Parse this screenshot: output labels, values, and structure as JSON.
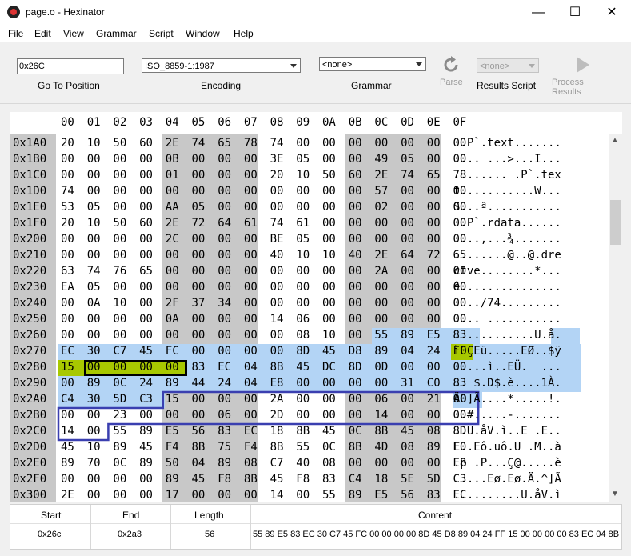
{
  "window": {
    "title": "page.o - Hexinator",
    "minimize": "—",
    "maximize": "☐",
    "close": "✕"
  },
  "menu": [
    "File",
    "Edit",
    "View",
    "Grammar",
    "Script",
    "Window",
    "Help"
  ],
  "toolbar": {
    "goto_value": "0x26C",
    "goto_label": "Go To Position",
    "encoding_value": "ISO_8859-1:1987",
    "encoding_label": "Encoding",
    "grammar_value": "<none>",
    "grammar_label": "Grammar",
    "parse_label": "Parse",
    "script_value": "<none>",
    "script_label": "Results Script",
    "process_label": "Process Results",
    "icons": {
      "parse": "refresh-icon",
      "process": "play-icon"
    }
  },
  "hex": {
    "columns": [
      "00",
      "01",
      "02",
      "03",
      "04",
      "05",
      "06",
      "07",
      "08",
      "09",
      "0A",
      "0B",
      "0C",
      "0D",
      "0E",
      "0F"
    ],
    "rows": [
      {
        "offset": "0x1A0",
        "bytes": [
          "20",
          "10",
          "50",
          "60",
          "2E",
          "74",
          "65",
          "78",
          "74",
          "00",
          "00",
          "00",
          "00",
          "00",
          "00",
          "00"
        ],
        "ascii": " .P`.text......."
      },
      {
        "offset": "0x1B0",
        "bytes": [
          "00",
          "00",
          "00",
          "00",
          "0B",
          "00",
          "00",
          "00",
          "3E",
          "05",
          "00",
          "00",
          "49",
          "05",
          "00",
          "00"
        ],
        "ascii": ".... ...>...I..."
      },
      {
        "offset": "0x1C0",
        "bytes": [
          "00",
          "00",
          "00",
          "00",
          "01",
          "00",
          "00",
          "00",
          "20",
          "10",
          "50",
          "60",
          "2E",
          "74",
          "65",
          "78"
        ],
        "ascii": "........ .P`.tex"
      },
      {
        "offset": "0x1D0",
        "bytes": [
          "74",
          "00",
          "00",
          "00",
          "00",
          "00",
          "00",
          "00",
          "00",
          "00",
          "00",
          "00",
          "57",
          "00",
          "00",
          "00"
        ],
        "ascii": "t...........W..."
      },
      {
        "offset": "0x1E0",
        "bytes": [
          "53",
          "05",
          "00",
          "00",
          "AA",
          "05",
          "00",
          "00",
          "00",
          "00",
          "00",
          "00",
          "02",
          "00",
          "00",
          "00"
        ],
        "ascii": "S...ª..........."
      },
      {
        "offset": "0x1F0",
        "bytes": [
          "20",
          "10",
          "50",
          "60",
          "2E",
          "72",
          "64",
          "61",
          "74",
          "61",
          "00",
          "00",
          "00",
          "00",
          "00",
          "00"
        ],
        "ascii": " .P`.rdata......"
      },
      {
        "offset": "0x200",
        "bytes": [
          "00",
          "00",
          "00",
          "00",
          "2C",
          "00",
          "00",
          "00",
          "BE",
          "05",
          "00",
          "00",
          "00",
          "00",
          "00",
          "00"
        ],
        "ascii": "....,...¾......."
      },
      {
        "offset": "0x210",
        "bytes": [
          "00",
          "00",
          "00",
          "00",
          "00",
          "00",
          "00",
          "00",
          "40",
          "10",
          "10",
          "40",
          "2E",
          "64",
          "72",
          "65"
        ],
        "ascii": "........@..@.dre"
      },
      {
        "offset": "0x220",
        "bytes": [
          "63",
          "74",
          "76",
          "65",
          "00",
          "00",
          "00",
          "00",
          "00",
          "00",
          "00",
          "00",
          "2A",
          "00",
          "00",
          "00"
        ],
        "ascii": "ctve........*..."
      },
      {
        "offset": "0x230",
        "bytes": [
          "EA",
          "05",
          "00",
          "00",
          "00",
          "00",
          "00",
          "00",
          "00",
          "00",
          "00",
          "00",
          "00",
          "00",
          "00",
          "00"
        ],
        "ascii": "ê..............."
      },
      {
        "offset": "0x240",
        "bytes": [
          "00",
          "0A",
          "10",
          "00",
          "2F",
          "37",
          "34",
          "00",
          "00",
          "00",
          "00",
          "00",
          "00",
          "00",
          "00",
          "00"
        ],
        "ascii": ". ../74........."
      },
      {
        "offset": "0x250",
        "bytes": [
          "00",
          "00",
          "00",
          "00",
          "0A",
          "00",
          "00",
          "00",
          "14",
          "06",
          "00",
          "00",
          "00",
          "00",
          "00",
          "00"
        ],
        "ascii": ".... ..........."
      },
      {
        "offset": "0x260",
        "bytes": [
          "00",
          "00",
          "00",
          "00",
          "00",
          "00",
          "00",
          "00",
          "00",
          "08",
          "10",
          "00",
          "55",
          "89",
          "E5",
          "83"
        ],
        "ascii": "............U.å."
      },
      {
        "offset": "0x270",
        "bytes": [
          "EC",
          "30",
          "C7",
          "45",
          "FC",
          "00",
          "00",
          "00",
          "00",
          "8D",
          "45",
          "D8",
          "89",
          "04",
          "24",
          "FF"
        ],
        "ascii": "ì0ÇEü.....EØ..$ÿ"
      },
      {
        "offset": "0x280",
        "bytes": [
          "15",
          "00",
          "00",
          "00",
          "00",
          "83",
          "EC",
          "04",
          "8B",
          "45",
          "DC",
          "8D",
          "0D",
          "00",
          "00",
          "00"
        ],
        "ascii": ".....ì..EÜ.  ..."
      },
      {
        "offset": "0x290",
        "bytes": [
          "00",
          "89",
          "0C",
          "24",
          "89",
          "44",
          "24",
          "04",
          "E8",
          "00",
          "00",
          "00",
          "00",
          "31",
          "C0",
          "83"
        ],
        "ascii": ".. $.D$.è....1À."
      },
      {
        "offset": "0x2A0",
        "bytes": [
          "C4",
          "30",
          "5D",
          "C3",
          "15",
          "00",
          "00",
          "00",
          "2A",
          "00",
          "00",
          "00",
          "06",
          "00",
          "21",
          "00"
        ],
        "ascii": "Ä0]Ã....*.....!."
      },
      {
        "offset": "0x2B0",
        "bytes": [
          "00",
          "00",
          "23",
          "00",
          "00",
          "00",
          "06",
          "00",
          "2D",
          "00",
          "00",
          "00",
          "14",
          "00",
          "00",
          "00"
        ],
        "ascii": "..#.....-......."
      },
      {
        "offset": "0x2C0",
        "bytes": [
          "14",
          "00",
          "55",
          "89",
          "E5",
          "56",
          "83",
          "EC",
          "18",
          "8B",
          "45",
          "0C",
          "8B",
          "45",
          "08",
          "8D"
        ],
        "ascii": "..U.åV.ì..E .E.."
      },
      {
        "offset": "0x2D0",
        "bytes": [
          "45",
          "10",
          "89",
          "45",
          "F4",
          "8B",
          "75",
          "F4",
          "8B",
          "55",
          "0C",
          "8B",
          "4D",
          "08",
          "89",
          "E0"
        ],
        "ascii": "E..Eô.uô.U .M..à"
      },
      {
        "offset": "0x2E0",
        "bytes": [
          "89",
          "70",
          "0C",
          "89",
          "50",
          "04",
          "89",
          "08",
          "C7",
          "40",
          "08",
          "00",
          "00",
          "00",
          "00",
          "E8"
        ],
        "ascii": ".p .P...Ç@.....è"
      },
      {
        "offset": "0x2F0",
        "bytes": [
          "00",
          "00",
          "00",
          "00",
          "89",
          "45",
          "F8",
          "8B",
          "45",
          "F8",
          "83",
          "C4",
          "18",
          "5E",
          "5D",
          "C3"
        ],
        "ascii": ".....Eø.Eø.Ä.^]Ã"
      },
      {
        "offset": "0x300",
        "bytes": [
          "2E",
          "00",
          "00",
          "00",
          "17",
          "00",
          "00",
          "00",
          "14",
          "00",
          "55",
          "89",
          "E5",
          "56",
          "83",
          "EC"
        ],
        "ascii": "..........U.åV.ì"
      }
    ]
  },
  "results": {
    "headers": {
      "start": "Start",
      "end": "End",
      "length": "Length",
      "content": "Content"
    },
    "row": {
      "start": "0x26c",
      "end": "0x2a3",
      "length": "56",
      "content": "55 89 E5 83 EC 30 C7 45 FC 00 00 00 00 8D 45 D8 89 04 24 FF 15 00 00 00 00 83 EC 04 8B..."
    }
  },
  "colors": {
    "selection": "#b3d4f5",
    "highlight": "#a8c800",
    "struct_outline": "#3a3fb0",
    "column_band": "#c8c8c8"
  }
}
